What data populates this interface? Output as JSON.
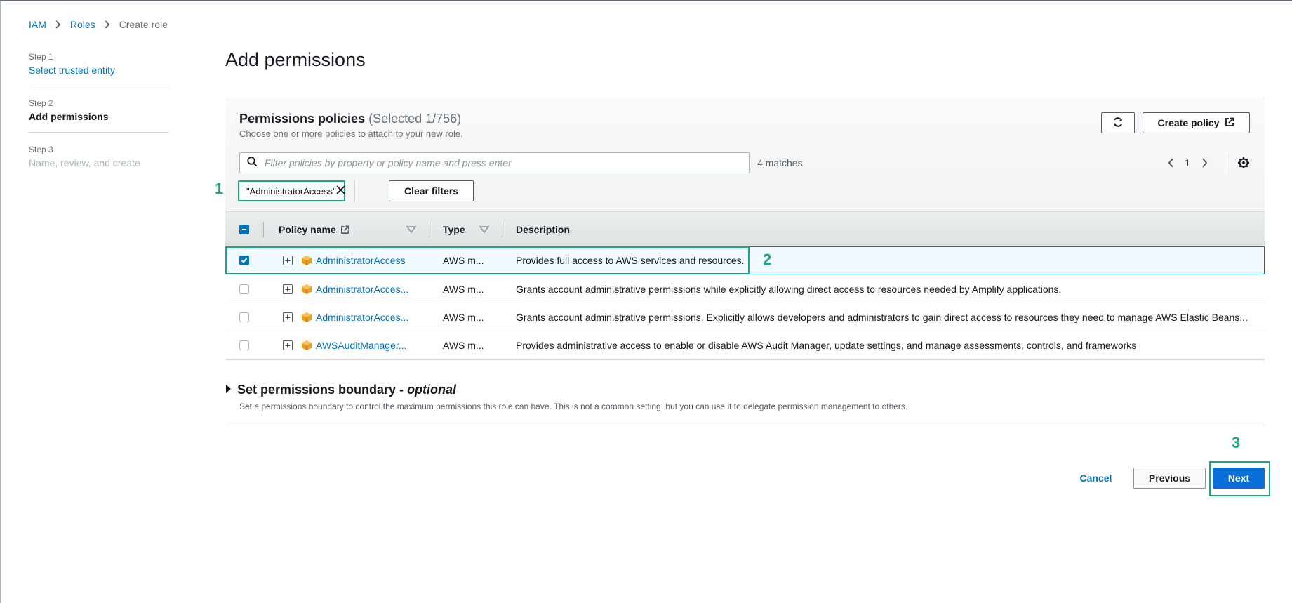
{
  "breadcrumb": {
    "items": [
      {
        "label": "IAM"
      },
      {
        "label": "Roles"
      },
      {
        "label": "Create role"
      }
    ]
  },
  "steps": [
    {
      "num": "Step 1",
      "title": "Select trusted entity",
      "state": "link"
    },
    {
      "num": "Step 2",
      "title": "Add permissions",
      "state": "active"
    },
    {
      "num": "Step 3",
      "title": "Name, review, and create",
      "state": "disabled"
    }
  ],
  "page": {
    "title": "Add permissions"
  },
  "policies": {
    "title": "Permissions policies",
    "count": "(Selected 1/756)",
    "subtitle": "Choose one or more policies to attach to your new role.",
    "refresh_icon": "refresh-icon",
    "create_label": "Create policy",
    "search_placeholder": "Filter policies by property or policy name and press enter",
    "matches": "4 matches",
    "page": "1",
    "filter_token": "\"AdministratorAccess\"",
    "clear_label": "Clear filters",
    "columns": {
      "name": "Policy name",
      "type": "Type",
      "description": "Description"
    },
    "rows": [
      {
        "name": "AdministratorAccess",
        "type": "AWS m...",
        "description": "Provides full access to AWS services and resources.",
        "checked": true
      },
      {
        "name": "AdministratorAcces...",
        "type": "AWS m...",
        "description": "Grants account administrative permissions while explicitly allowing direct access to resources needed by Amplify applications.",
        "checked": false
      },
      {
        "name": "AdministratorAcces...",
        "type": "AWS m...",
        "description": "Grants account administrative permissions. Explicitly allows developers and administrators to gain direct access to resources they need to manage AWS Elastic Beans...",
        "checked": false
      },
      {
        "name": "AWSAuditManager...",
        "type": "AWS m...",
        "description": "Provides administrative access to enable or disable AWS Audit Manager, update settings, and manage assessments, controls, and frameworks",
        "checked": false
      }
    ]
  },
  "annotations": {
    "one": "1",
    "two": "2",
    "three": "3"
  },
  "boundary": {
    "title": "Set permissions boundary - ",
    "optional": "optional",
    "description": "Set a permissions boundary to control the maximum permissions this role can have. This is not a common setting, but you can use it to delegate permission management to others."
  },
  "footer": {
    "cancel": "Cancel",
    "previous": "Previous",
    "next": "Next"
  },
  "colors": {
    "link": "#0073bb",
    "annotation": "#1ba781",
    "primary": "#0a6fd8",
    "policy_icon": "#ec9d20"
  }
}
